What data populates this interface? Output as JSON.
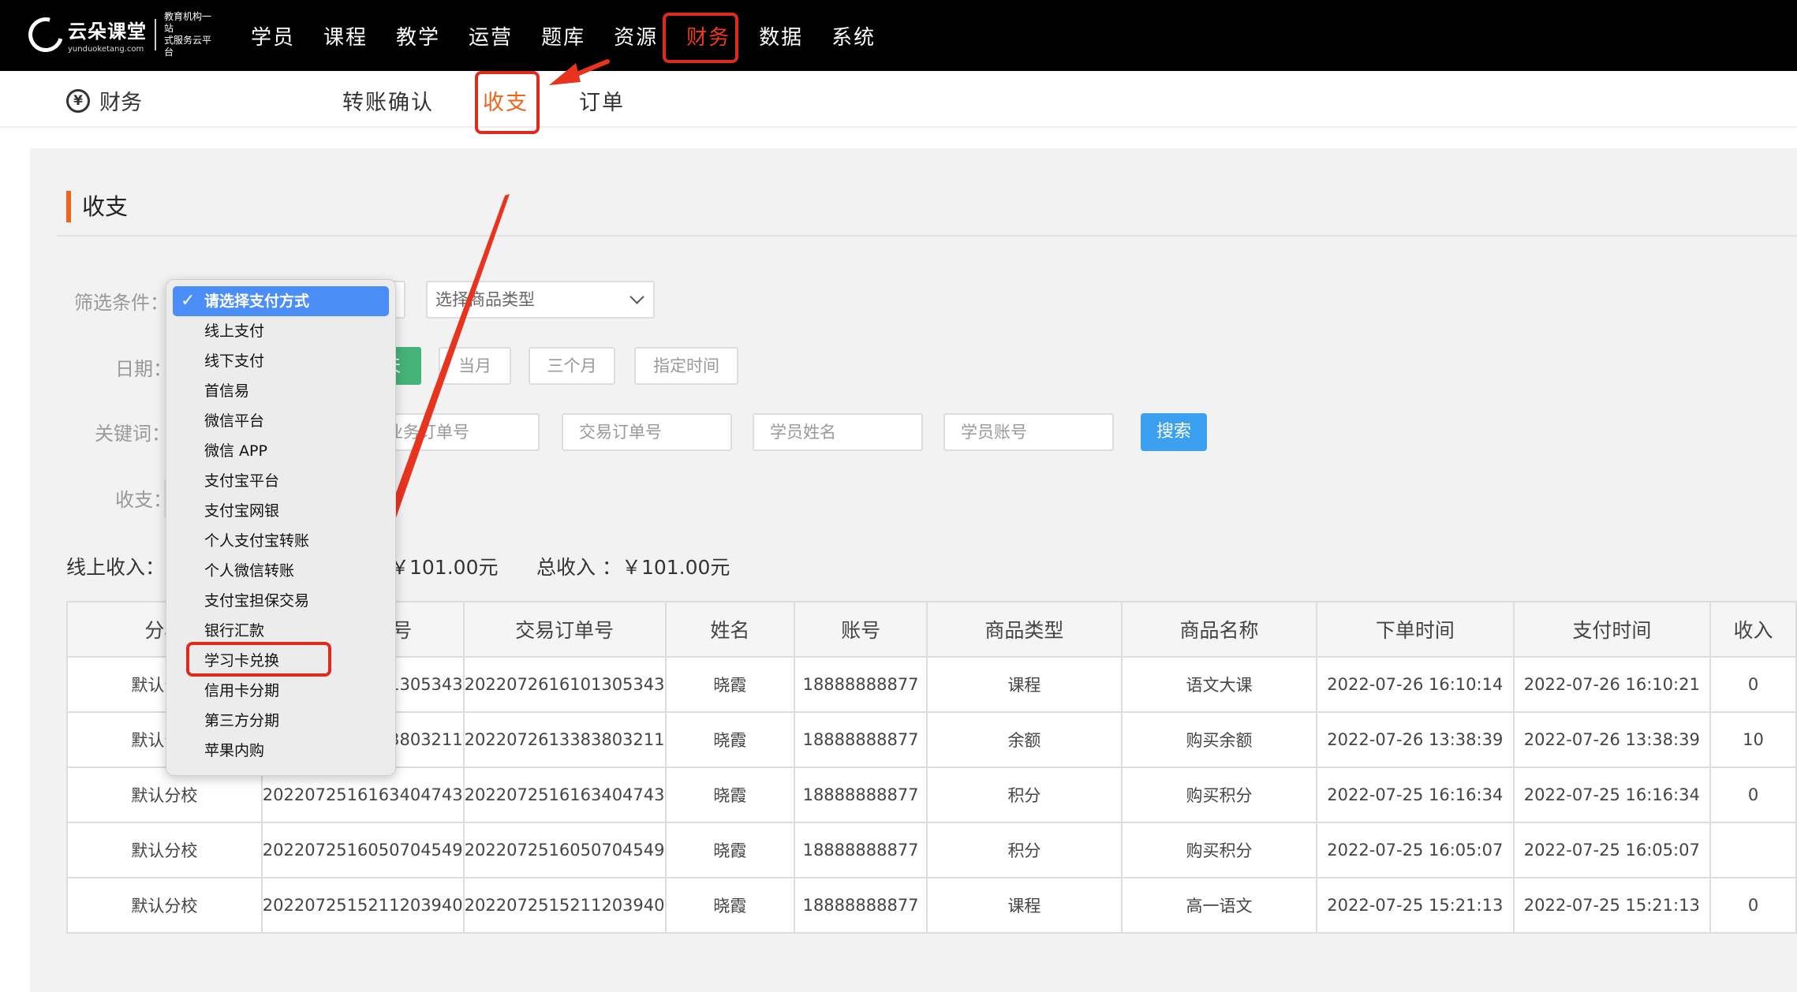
{
  "topbar": {
    "logo": {
      "name": "云朵课堂",
      "domain": "yunduoketang.com",
      "slogan_line1": "教育机构一站",
      "slogan_line2": "式服务云平台"
    },
    "nav": [
      "学员",
      "课程",
      "教学",
      "运营",
      "题库",
      "资源",
      "财务",
      "数据",
      "系统"
    ],
    "active": "财务"
  },
  "subnav": {
    "section": "财务",
    "tabs": [
      "转账确认",
      "收支",
      "订单"
    ],
    "active": "收支"
  },
  "page_title": "收支",
  "filters": {
    "condition_label": "筛选条件：",
    "goods_type_placeholder": "选择商品类型",
    "date_label": "日期：",
    "date_buttons": [
      "天",
      "当月",
      "三个月",
      "指定时间"
    ],
    "keyword_label": "关键词：",
    "inputs": [
      "业务订单号",
      "交易订单号",
      "学员姓名",
      "学员账号"
    ],
    "search_label": "搜索",
    "income_label": "收支："
  },
  "summary": {
    "online_label": "线上收入：",
    "mid_value": "￥101.00元",
    "total": "总收入 ：￥101.00元"
  },
  "table": {
    "headers": [
      "分校",
      "业务订单号",
      "交易订单号",
      "姓名",
      "账号",
      "商品类型",
      "商品名称",
      "下单时间",
      "支付时间",
      "收入"
    ],
    "rows": [
      [
        "默认分校",
        "2022072616101305343",
        "2022072616101305343",
        "晓霞",
        "18888888877",
        "课程",
        "语文大课",
        "2022-07-26 16:10:14",
        "2022-07-26 16:10:21",
        "0"
      ],
      [
        "默认分校",
        "2022072613383803211",
        "2022072613383803211",
        "晓霞",
        "18888888877",
        "余额",
        "购买余额",
        "2022-07-26 13:38:39",
        "2022-07-26 13:38:39",
        "10"
      ],
      [
        "默认分校",
        "2022072516163404743",
        "2022072516163404743",
        "晓霞",
        "18888888877",
        "积分",
        "购买积分",
        "2022-07-25 16:16:34",
        "2022-07-25 16:16:34",
        "0"
      ],
      [
        "默认分校",
        "2022072516050704549",
        "2022072516050704549",
        "晓霞",
        "18888888877",
        "积分",
        "购买积分",
        "2022-07-25 16:05:07",
        "2022-07-25 16:05:07",
        ""
      ],
      [
        "默认分校",
        "2022072515211203940",
        "2022072515211203940",
        "晓霞",
        "18888888877",
        "课程",
        "高一语文",
        "2022-07-25 15:21:13",
        "2022-07-25 15:21:13",
        "0"
      ]
    ]
  },
  "payment_dropdown": {
    "selected": "请选择支付方式",
    "options": [
      "线上支付",
      "线下支付",
      "首信易",
      "微信平台",
      "微信 APP",
      "支付宝平台",
      "支付宝网银",
      "个人支付宝转账",
      "个人微信转账",
      "支付宝担保交易",
      "银行汇款",
      "学习卡兑换",
      "信用卡分期",
      "第三方分期",
      "苹果内购"
    ],
    "highlighted": "学习卡兑换"
  },
  "colors": {
    "accent": "#f0641e",
    "annotation": "#e02a1e",
    "search": "#3ba0f0",
    "date_active": "#46b378",
    "dropdown_selected": "#4c8ef8"
  }
}
